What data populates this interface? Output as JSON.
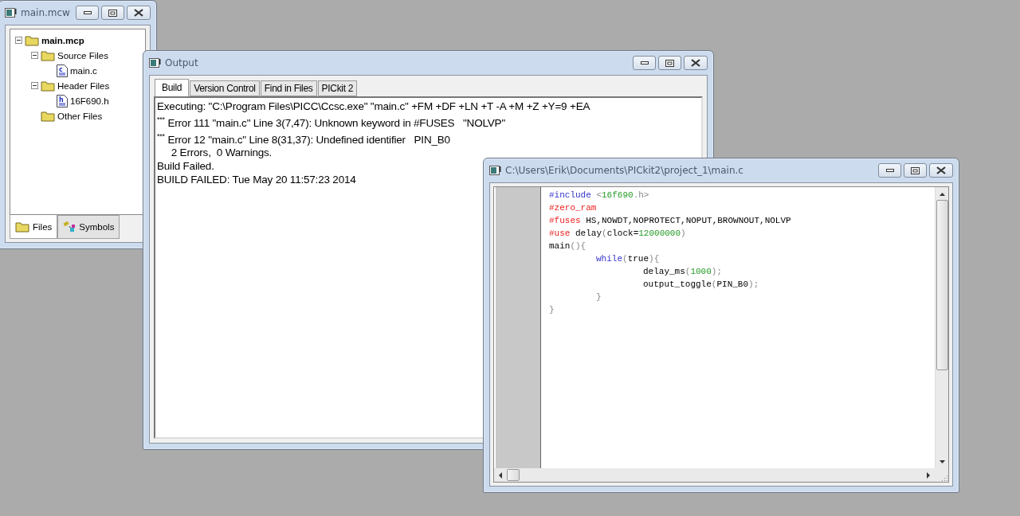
{
  "project_window": {
    "title": "main.mcw",
    "tree": [
      {
        "label": "main.mcp",
        "kind": "project",
        "expanded": true,
        "children": [
          {
            "label": "Source Files",
            "kind": "folder",
            "expanded": true,
            "children": [
              {
                "label": "main.c",
                "kind": "file",
                "badge": "c"
              }
            ]
          },
          {
            "label": "Header Files",
            "kind": "folder",
            "expanded": true,
            "children": [
              {
                "label": "16F690.h",
                "kind": "file",
                "badge": "h"
              }
            ]
          },
          {
            "label": "Other Files",
            "kind": "folder"
          }
        ]
      }
    ],
    "tabs": [
      {
        "label": "Files",
        "kind": "files",
        "selected": true
      },
      {
        "label": "Symbols",
        "kind": "symbols",
        "selected": false
      }
    ]
  },
  "output_window": {
    "title": "Output",
    "tabs": [
      {
        "label": "Build",
        "selected": true
      },
      {
        "label": "Version Control",
        "selected": false
      },
      {
        "label": "Find in Files",
        "selected": false
      },
      {
        "label": "PICkit 2",
        "selected": false
      }
    ],
    "lines": [
      "Executing: \"C:\\Program Files\\PICC\\Ccsc.exe\" \"main.c\" +FM +DF +LN +T -A +M +Z +Y=9 +EA",
      "$^{***}$ Error 111 \"main.c\" Line 3(7,47): Unknown keyword in #FUSES   \"NOLVP\"",
      "$^{***}$ Error 12 \"main.c\" Line 8(31,37): Undefined identifier   PIN_B0",
      "     2 Errors,  0 Warnings.",
      "Build Failed.",
      "BUILD FAILED: Tue May 20 11:57:23 2014"
    ]
  },
  "editor_window": {
    "title": "C:\\Users\\Erik\\Documents\\PICkit2\\project_1\\main.c",
    "code": [
      {
        "tokens": [
          {
            "text": "#include",
            "kind": "keyword"
          },
          {
            "text": " <",
            "kind": "punct"
          },
          {
            "text": "16f690",
            "kind": "number"
          },
          {
            "text": ".h>",
            "kind": "punct"
          }
        ]
      },
      {
        "tokens": [
          {
            "text": "#zero_ram",
            "kind": "directive"
          }
        ]
      },
      {
        "tokens": [
          {
            "text": "#fuses",
            "kind": "directive"
          },
          {
            "text": " HS,NOWDT,NOPROTECT,NOPUT,BROWNOUT,NOLVP",
            "kind": "plain"
          }
        ]
      },
      {
        "tokens": [
          {
            "text": "#use",
            "kind": "directive"
          },
          {
            "text": " delay",
            "kind": "plain"
          },
          {
            "text": "(",
            "kind": "punct"
          },
          {
            "text": "clock=",
            "kind": "plain"
          },
          {
            "text": "12000000",
            "kind": "number"
          },
          {
            "text": ")",
            "kind": "punct"
          }
        ]
      },
      {
        "tokens": [
          {
            "text": "main",
            "kind": "plain"
          },
          {
            "text": "(){",
            "kind": "punct"
          }
        ],
        "children": [
          {
            "tokens": [
              {
                "text": "while",
                "kind": "keyword"
              },
              {
                "text": "(",
                "kind": "punct"
              },
              {
                "text": "true",
                "kind": "plain"
              },
              {
                "text": "){",
                "kind": "punct"
              }
            ],
            "children": [
              {
                "tokens": [
                  {
                    "text": "delay_ms",
                    "kind": "plain"
                  },
                  {
                    "text": "(",
                    "kind": "punct"
                  },
                  {
                    "text": "1000",
                    "kind": "number"
                  },
                  {
                    "text": ");",
                    "kind": "punct"
                  }
                ]
              },
              {
                "tokens": [
                  {
                    "text": "output_toggle",
                    "kind": "plain"
                  },
                  {
                    "text": "(",
                    "kind": "punct"
                  },
                  {
                    "text": "PIN_B0",
                    "kind": "plain"
                  },
                  {
                    "text": ");",
                    "kind": "punct"
                  }
                ]
              }
            ]
          },
          {
            "tokens": [
              {
                "text": "}",
                "kind": "punct"
              }
            ]
          }
        ]
      },
      {
        "tokens": [
          {
            "text": "}",
            "kind": "punct"
          }
        ]
      }
    ]
  }
}
